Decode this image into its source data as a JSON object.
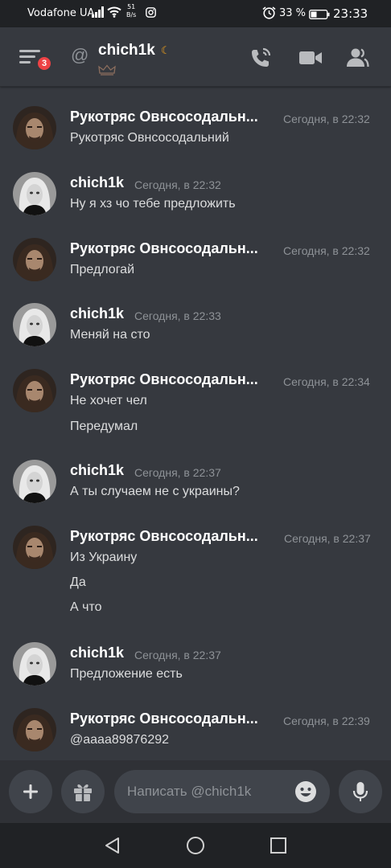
{
  "status_bar": {
    "carrier": "Vodafone UA",
    "speed_value": "51",
    "speed_unit": "B/s",
    "battery": "33 %",
    "time": "23:33"
  },
  "header": {
    "channel_name": "chich1k",
    "notification_badge": "3",
    "icons": [
      "hamburger-menu-icon",
      "at-icon",
      "moon-status-icon",
      "crown-icon",
      "phone-call-icon",
      "video-call-icon",
      "members-icon"
    ]
  },
  "messages": [
    {
      "author": "Рукотряс Овнсосодальн...",
      "time": "Сегодня, в 22:32",
      "avatar": "avatar-man",
      "lines": [
        "Рукотряс Овнсосодальний"
      ]
    },
    {
      "author": "chich1k",
      "time": "Сегодня, в 22:32",
      "avatar": "avatar-girl",
      "lines": [
        "Ну я хз чо тебе предложить"
      ]
    },
    {
      "author": "Рукотряс Овнсосодальн...",
      "time": "Сегодня, в 22:32",
      "avatar": "avatar-man",
      "lines": [
        "Предлогай"
      ]
    },
    {
      "author": "chich1k",
      "time": "Сегодня, в 22:33",
      "avatar": "avatar-girl",
      "lines": [
        "Меняй на сто"
      ]
    },
    {
      "author": "Рукотряс Овнсосодальн...",
      "time": "Сегодня, в 22:34",
      "avatar": "avatar-man",
      "lines": [
        "Не хочет чел",
        "Передумал"
      ]
    },
    {
      "author": "chich1k",
      "time": "Сегодня, в 22:37",
      "avatar": "avatar-girl",
      "lines": [
        "А ты случаем не с украины?"
      ]
    },
    {
      "author": "Рукотряс Овнсосодальн...",
      "time": "Сегодня, в 22:37",
      "avatar": "avatar-man",
      "lines": [
        "Из Украину",
        "Да",
        "А что"
      ]
    },
    {
      "author": "chich1k",
      "time": "Сегодня, в 22:37",
      "avatar": "avatar-girl",
      "lines": [
        "Предложение есть"
      ]
    },
    {
      "author": "Рукотряс Овнсосодальн...",
      "time": "Сегодня, в 22:39",
      "avatar": "avatar-man",
      "lines": [
        "@aaaa89876292"
      ]
    }
  ],
  "composer": {
    "placeholder": "Написать @chich1k",
    "value": ""
  },
  "colors": {
    "background": "#36393f",
    "composer_bg": "#2f3136",
    "badge": "#ed4245",
    "status_moon": "#faa61a",
    "timestamp": "#8e9297",
    "text": "#dcddde"
  }
}
